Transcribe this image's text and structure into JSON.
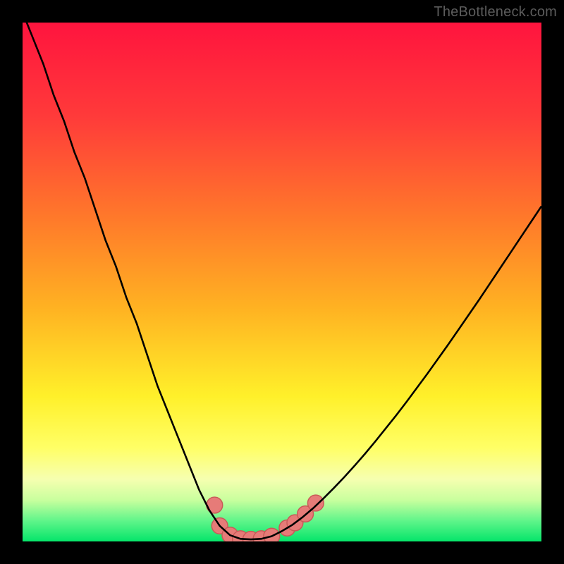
{
  "watermark": "TheBottleneck.com",
  "colors": {
    "background": "#000000",
    "gradient_stops": [
      {
        "offset": 0.0,
        "color": "#ff143e"
      },
      {
        "offset": 0.18,
        "color": "#ff3a3a"
      },
      {
        "offset": 0.38,
        "color": "#ff7a2a"
      },
      {
        "offset": 0.55,
        "color": "#ffb222"
      },
      {
        "offset": 0.72,
        "color": "#fff02a"
      },
      {
        "offset": 0.82,
        "color": "#ffff66"
      },
      {
        "offset": 0.88,
        "color": "#f6ffb0"
      },
      {
        "offset": 0.92,
        "color": "#c9ff9e"
      },
      {
        "offset": 0.96,
        "color": "#60f58a"
      },
      {
        "offset": 1.0,
        "color": "#05e56a"
      }
    ],
    "curve": "#000000",
    "marker_fill": "#e67b78",
    "marker_stroke": "#c85a58"
  },
  "chart_data": {
    "type": "line",
    "title": "",
    "xlabel": "",
    "ylabel": "",
    "xlim": [
      0,
      100
    ],
    "ylim": [
      0,
      100
    ],
    "grid": false,
    "legend": false,
    "x": [
      0,
      2,
      4,
      6,
      8,
      10,
      12,
      14,
      16,
      18,
      20,
      22,
      24,
      26,
      28,
      30,
      32,
      34,
      36,
      38,
      40,
      42,
      44,
      46,
      48,
      50,
      52,
      54,
      56,
      58,
      60,
      62,
      64,
      66,
      68,
      70,
      72,
      74,
      76,
      78,
      80,
      82,
      84,
      86,
      88,
      90,
      92,
      94,
      96,
      98,
      100
    ],
    "values": [
      102,
      97,
      92,
      86,
      81,
      75,
      70,
      64,
      58,
      53,
      47,
      42,
      36,
      30,
      25,
      20,
      15,
      10,
      6,
      3,
      1.2,
      0.5,
      0.4,
      0.5,
      1,
      2,
      3.2,
      4.7,
      6.4,
      8.3,
      10.3,
      12.4,
      14.6,
      16.9,
      19.3,
      21.8,
      24.3,
      26.9,
      29.6,
      32.3,
      35.1,
      37.9,
      40.8,
      43.7,
      46.6,
      49.6,
      52.6,
      55.6,
      58.6,
      61.6,
      64.6
    ],
    "markers": {
      "comment": "Approximate marker positions near the curve minimum",
      "points": [
        {
          "x": 37,
          "y": 7
        },
        {
          "x": 38,
          "y": 3
        },
        {
          "x": 40,
          "y": 1.2
        },
        {
          "x": 42,
          "y": 0.5
        },
        {
          "x": 44,
          "y": 0.4
        },
        {
          "x": 46,
          "y": 0.5
        },
        {
          "x": 48,
          "y": 1
        },
        {
          "x": 51,
          "y": 2.6
        },
        {
          "x": 52.5,
          "y": 3.6
        },
        {
          "x": 54.5,
          "y": 5.3
        },
        {
          "x": 56.5,
          "y": 7.4
        }
      ]
    }
  }
}
